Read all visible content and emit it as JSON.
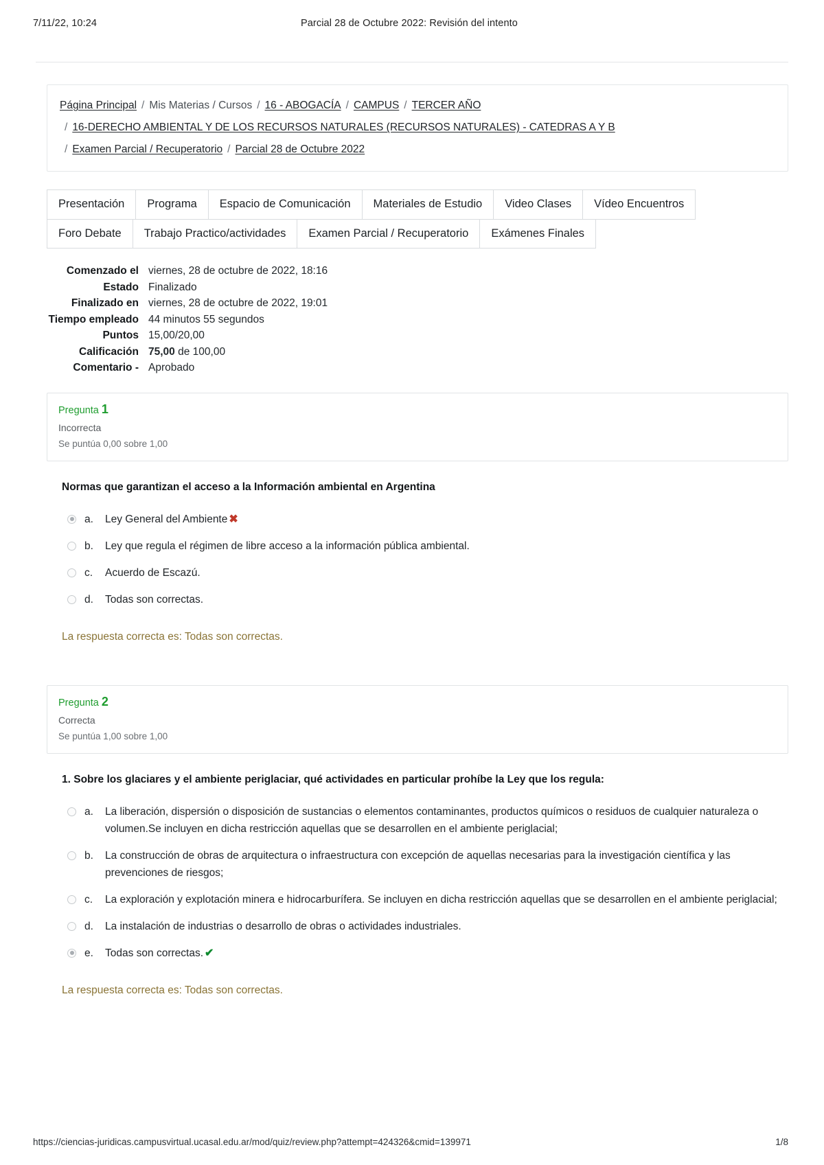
{
  "print_header": {
    "date": "7/11/22, 10:24",
    "title": "Parcial 28 de Octubre 2022: Revisión del intento"
  },
  "breadcrumb": {
    "line1": [
      {
        "text": "Página Principal",
        "link": true
      },
      {
        "text": "/",
        "sep": true
      },
      {
        "text": "Mis Materias / Cursos",
        "link": false
      },
      {
        "text": "/",
        "sep": true
      },
      {
        "text": "16 - ABOGACÍA",
        "link": true
      },
      {
        "text": "/",
        "sep": true
      },
      {
        "text": "CAMPUS",
        "link": true
      },
      {
        "text": "/",
        "sep": true
      },
      {
        "text": "TERCER AÑO",
        "link": true
      }
    ],
    "line2": [
      {
        "text": "/",
        "sep": true
      },
      {
        "text": "16-DERECHO AMBIENTAL Y DE LOS RECURSOS NATURALES (RECURSOS NATURALES) - CATEDRAS A Y B",
        "link": true
      }
    ],
    "line3": [
      {
        "text": "/",
        "sep": true
      },
      {
        "text": "Examen Parcial / Recuperatorio",
        "link": true
      },
      {
        "text": "/",
        "sep": true
      },
      {
        "text": "Parcial 28 de Octubre 2022",
        "link": true
      }
    ]
  },
  "tabs": {
    "row1": [
      "Presentación",
      "Programa",
      "Espacio de Comunicación",
      "Materiales de Estudio",
      "Video Clases",
      "Vídeo Encuentros"
    ],
    "row2": [
      "Foro Debate",
      "Trabajo Practico/actividades",
      "Examen Parcial / Recuperatorio",
      "Exámenes Finales"
    ]
  },
  "summary": [
    {
      "label": "Comenzado el",
      "value": "viernes, 28 de octubre de 2022, 18:16",
      "bold_value": ""
    },
    {
      "label": "Estado",
      "value": "Finalizado",
      "bold_value": ""
    },
    {
      "label": "Finalizado en",
      "value": "viernes, 28 de octubre de 2022, 19:01",
      "bold_value": ""
    },
    {
      "label": "Tiempo empleado",
      "value": "44 minutos 55 segundos",
      "bold_value": ""
    },
    {
      "label": "Puntos",
      "value": "15,00/20,00",
      "bold_value": ""
    },
    {
      "label": "Calificación",
      "value": " de 100,00",
      "bold_value": "75,00"
    },
    {
      "label": "Comentario -",
      "value": "Aprobado",
      "bold_value": ""
    }
  ],
  "questions": [
    {
      "number_label": "Pregunta",
      "number": "1",
      "state": "Incorrecta",
      "marks": "Se puntúa 0,00 sobre 1,00",
      "prefix": "",
      "text": "Normas que garantizan el acceso a la Información ambiental en Argentina",
      "options": [
        {
          "letter": "a.",
          "text": "Ley General del Ambiente",
          "selected": true,
          "mark": "wrong"
        },
        {
          "letter": "b.",
          "text": "Ley que regula el régimen de libre acceso a la información pública ambiental.",
          "selected": false,
          "mark": ""
        },
        {
          "letter": "c.",
          "text": "Acuerdo de Escazú.",
          "selected": false,
          "mark": ""
        },
        {
          "letter": "d.",
          "text": "Todas son correctas.",
          "selected": false,
          "mark": ""
        }
      ],
      "feedback": "La respuesta correcta es: Todas son correctas."
    },
    {
      "number_label": "Pregunta",
      "number": "2",
      "state": "Correcta",
      "marks": "Se puntúa 1,00 sobre 1,00",
      "prefix": "1. ",
      "text": "Sobre los glaciares y el ambiente periglaciar, qué actividades en particular prohíbe la Ley que los regula:",
      "options": [
        {
          "letter": "a.",
          "text": "La liberación, dispersión o disposición de sustancias o elementos contaminantes, productos químicos o residuos de cualquier naturaleza o volumen.Se incluyen en dicha restricción aquellas que se desarrollen en el ambiente periglacial;",
          "selected": false,
          "mark": ""
        },
        {
          "letter": "b.",
          "text": "La construcción de obras de arquitectura o infraestructura con excepción de aquellas necesarias para la investigación científica y las prevenciones de riesgos;",
          "selected": false,
          "mark": ""
        },
        {
          "letter": "c.",
          "text": "La exploración y explotación minera e hidrocarburífera. Se incluyen en dicha restricción aquellas que se desarrollen en el ambiente periglacial;",
          "selected": false,
          "mark": ""
        },
        {
          "letter": "d.",
          "text": "La instalación de industrias o desarrollo de obras o actividades industriales.",
          "selected": false,
          "mark": ""
        },
        {
          "letter": "e.",
          "text": "Todas son correctas.",
          "selected": true,
          "mark": "right"
        }
      ],
      "feedback": "La respuesta correcta es: Todas son correctas."
    }
  ],
  "icons": {
    "wrong_mark": "✖",
    "right_mark": "✔"
  },
  "footer": {
    "url": "https://ciencias-juridicas.campusvirtual.ucasal.edu.ar/mod/quiz/review.php?attempt=424326&cmid=139971",
    "page": "1/8"
  },
  "colors": {
    "question_number": "#1f9d2f",
    "feedback": "#8a7436",
    "wrong": "#c0392b",
    "right": "#0f8a2f"
  }
}
